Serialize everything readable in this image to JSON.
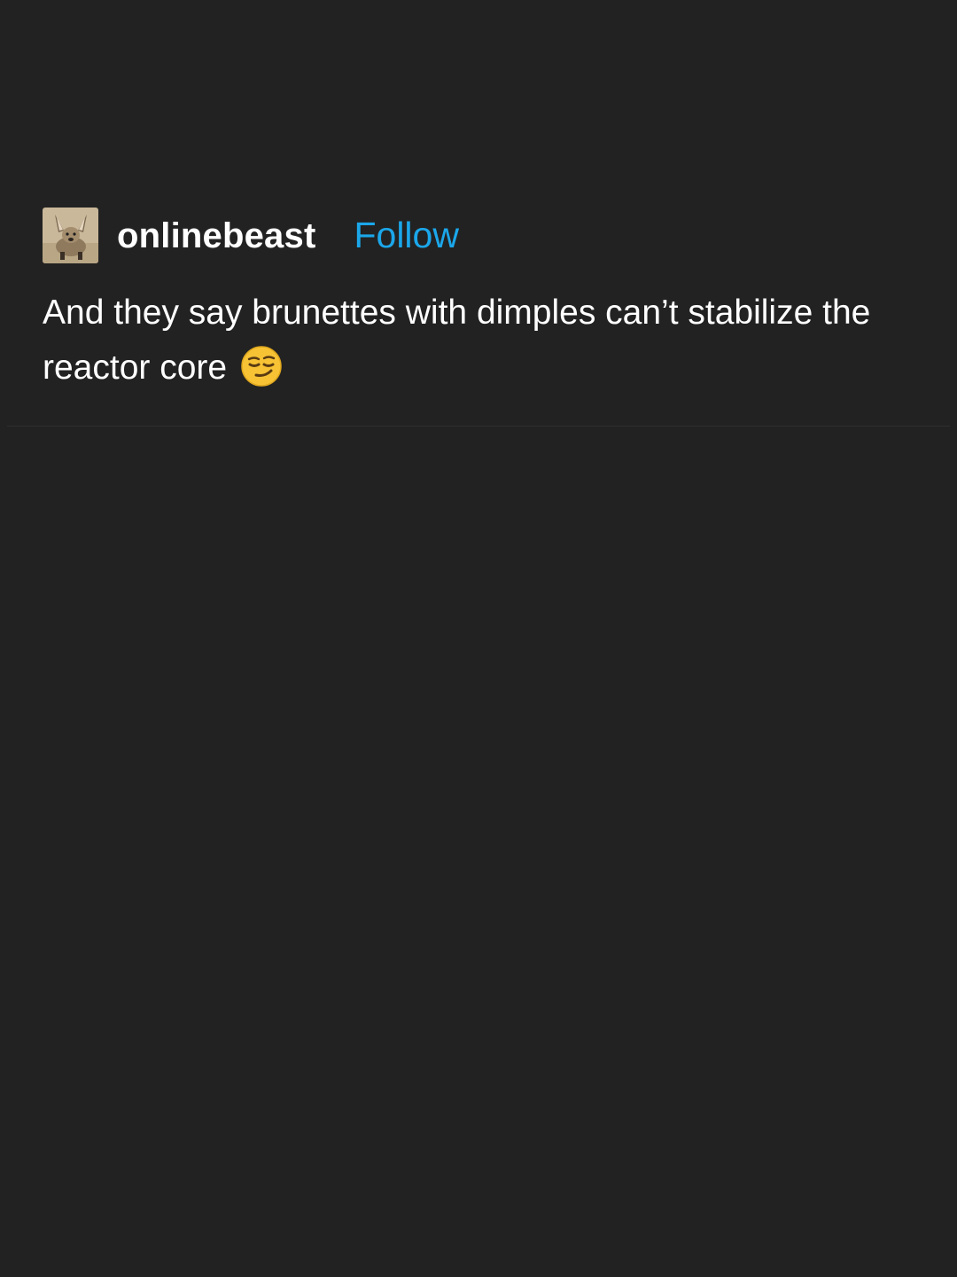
{
  "post": {
    "username": "onlinebeast",
    "follow_label": "Follow",
    "text": "And they say brunettes with dimples can’t stabilize the reactor core",
    "avatar_icon": "bat-eared-fox-avatar",
    "emoji_icon": "smirking-face-icon"
  },
  "colors": {
    "background": "#222222",
    "text": "#ffffff",
    "follow": "#1ba7ea"
  }
}
